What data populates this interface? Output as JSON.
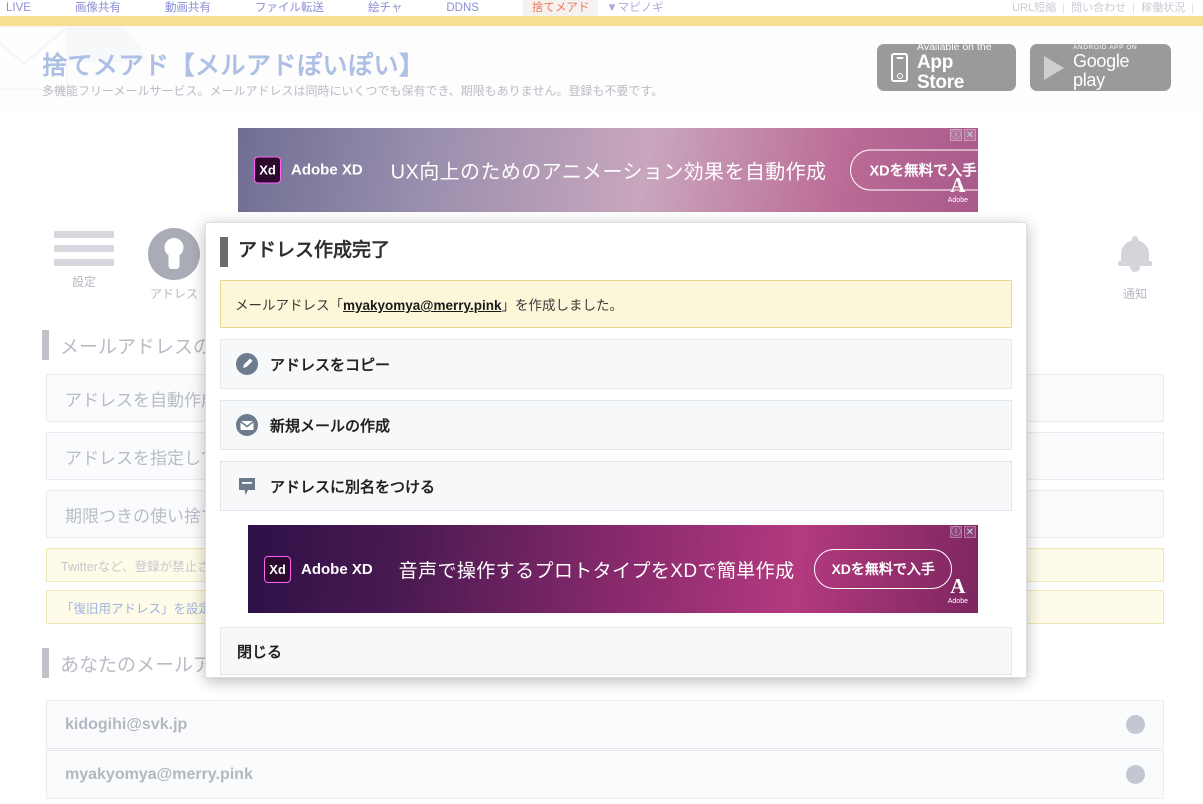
{
  "topnav": {
    "left_items": [
      {
        "label": "LIVE",
        "active": false
      },
      {
        "label": "画像共有",
        "active": false
      },
      {
        "label": "動画共有",
        "active": false
      },
      {
        "label": "ファイル転送",
        "active": false
      },
      {
        "label": "絵チャ",
        "active": false
      },
      {
        "label": "DDNS",
        "active": false
      },
      {
        "label": "捨てメアド",
        "active": true
      },
      {
        "label": "▼マピノギ",
        "active": false
      }
    ],
    "right_items": [
      "URL短縮",
      "問い合わせ",
      "稼働状況"
    ],
    "separator": "|",
    "active_color": "#e8785a",
    "link_color": "#8b8fd4",
    "gold_bar_color": "#f7de92"
  },
  "header": {
    "title": "捨てメアド【メルアドぽいぽい】",
    "subtitle": "多機能フリーメールサービス。メールアドレスは同時にいくつでも保有でき、期限もありません。登録も不要です。",
    "title_color": "#adbfe4",
    "badges": {
      "appstore": {
        "small": "Available on the",
        "big": "App Store",
        "icon": "iphone-icon"
      },
      "googleplay": {
        "tiny": "ANDROID APP ON",
        "big": "Google play",
        "icon": "play-triangle-icon"
      }
    }
  },
  "ads": {
    "top": {
      "brand": "Adobe XD",
      "logo_text": "Xd",
      "copy": "UX向上のためのアニメーション効果を自動作成",
      "cta": "XDを無料で入手",
      "adobe_mark": "Adobe",
      "info_icon": "ⓘ",
      "close_icon": "✕"
    },
    "modal": {
      "brand": "Adobe XD",
      "logo_text": "Xd",
      "copy": "音声で操作するプロトタイプをXDで簡単作成",
      "cta": "XDを無料で入手",
      "adobe_mark": "Adobe",
      "info_icon": "ⓘ",
      "close_icon": "✕"
    }
  },
  "background": {
    "tools": [
      {
        "label": "設定",
        "icon": "hamburger-menu-icon"
      },
      {
        "label": "アドレス",
        "icon": "keyhole-icon"
      },
      {
        "label": "通知",
        "icon": "bell-icon"
      }
    ],
    "section_add_title": "メールアドレスの追加",
    "add_items": [
      "アドレスを自動作成",
      "アドレスを指定して",
      "期限つきの使い捨て"
    ],
    "notices": [
      "Twitterなど、登録が禁止され",
      "「復旧用アドレス」を設定してお"
    ],
    "section_mine_title": "あなたのメールア",
    "addresses": [
      "kidogihi@svk.jp",
      "myakyomya@merry.pink"
    ]
  },
  "modal": {
    "title": "アドレス作成完了",
    "notice_prefix": "メールアドレス「",
    "notice_email": "myakyomya@merry.pink",
    "notice_suffix": "」を作成しました。",
    "items": [
      {
        "label": "アドレスをコピー",
        "icon": "pencil-circle-icon"
      },
      {
        "label": "新規メールの作成",
        "icon": "envelope-circle-icon"
      },
      {
        "label": "アドレスに別名をつける",
        "icon": "speech-bubble-icon"
      }
    ],
    "close_label": "閉じる"
  }
}
